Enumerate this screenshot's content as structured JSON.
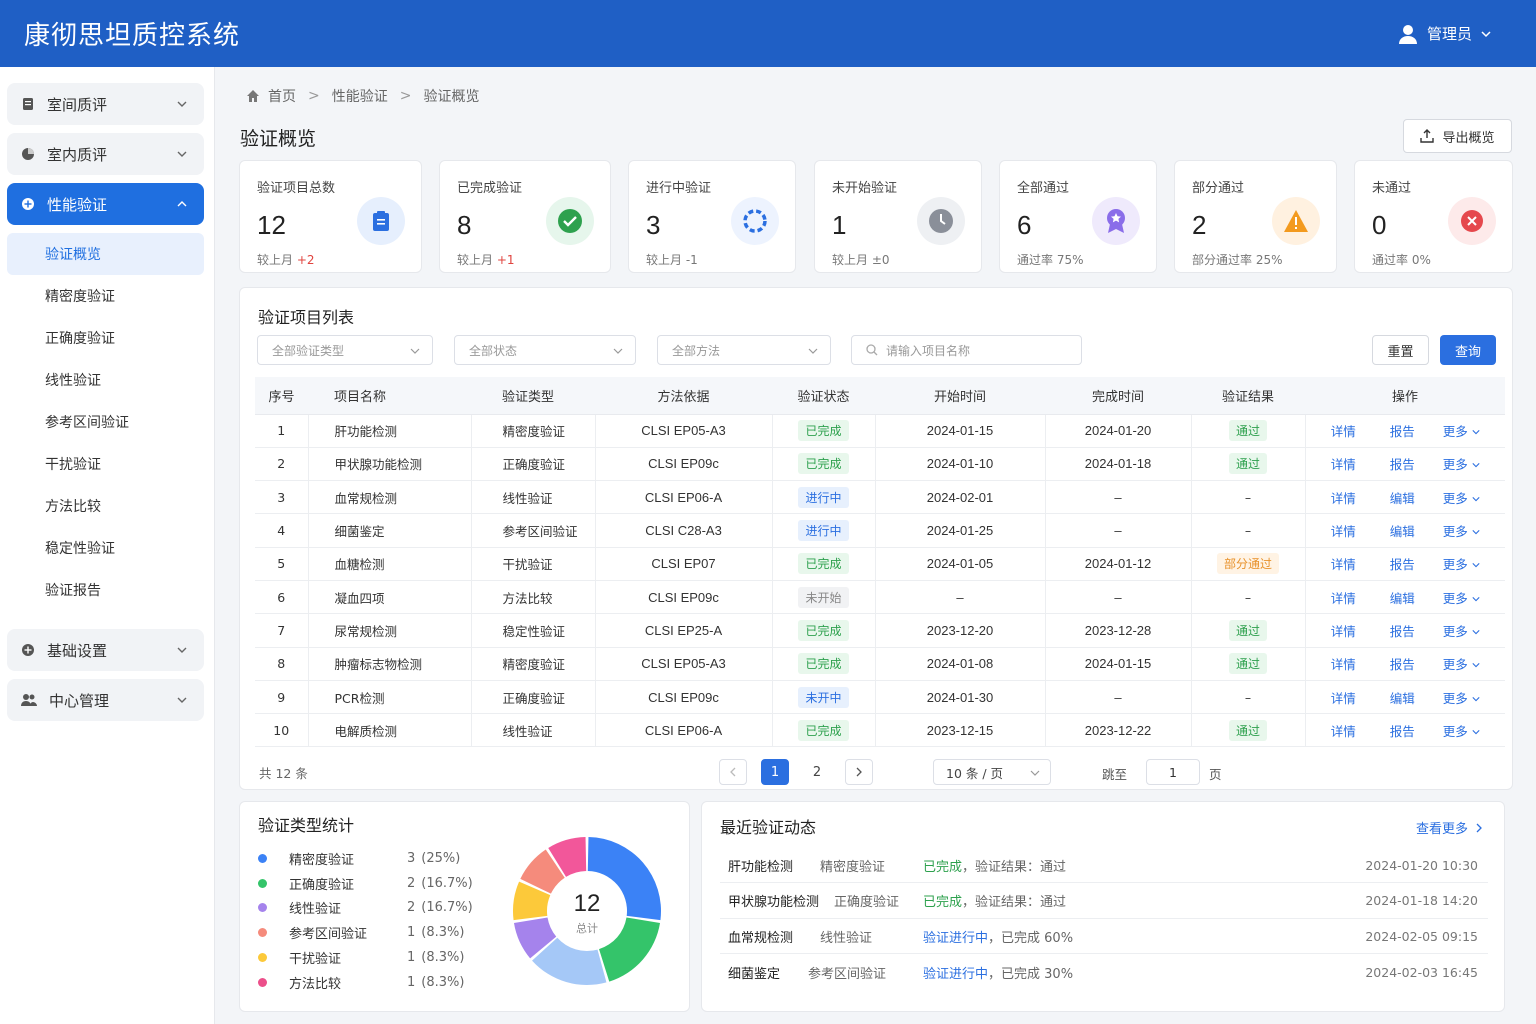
{
  "app_title": "康彻思坦质控系统",
  "user": {
    "name": "管理员"
  },
  "sidebar": {
    "groups_top": [
      {
        "label": "室间质评"
      },
      {
        "label": "室内质评"
      }
    ],
    "active_group": {
      "label": "性能验证"
    },
    "sub_items": [
      {
        "label": "验证概览"
      },
      {
        "label": "精密度验证"
      },
      {
        "label": "正确度验证"
      },
      {
        "label": "线性验证"
      },
      {
        "label": "参考区间验证"
      },
      {
        "label": "干扰验证"
      },
      {
        "label": "方法比较"
      },
      {
        "label": "稳定性验证"
      },
      {
        "label": "验证报告"
      }
    ],
    "groups_bottom": [
      {
        "label": "基础设置"
      },
      {
        "label": "中心管理"
      }
    ]
  },
  "breadcrumb": {
    "home": "首页",
    "level1": "性能验证",
    "level2": "验证概览"
  },
  "page_title": "验证概览",
  "export_label": "导出概览",
  "stats": [
    {
      "label": "验证项目总数",
      "value": "12",
      "sub_prefix": "较上月",
      "sub_value": "+2",
      "color": "#2b6fe0",
      "icon": "clipboard-icon"
    },
    {
      "label": "已完成验证",
      "value": "8",
      "sub_prefix": "较上月",
      "sub_value": "+1",
      "color": "#2ea14e",
      "icon": "check-circle-icon"
    },
    {
      "label": "进行中验证",
      "value": "3",
      "sub_prefix": "较上月",
      "sub_value": "-1",
      "color": "#2b6fe0",
      "icon": "loading-ring-icon"
    },
    {
      "label": "未开始验证",
      "value": "1",
      "sub_prefix": "较上月",
      "sub_value": "±0",
      "color": "#8a8f99",
      "icon": "clock-icon"
    },
    {
      "label": "全部通过",
      "value": "6",
      "sub_prefix": "通过率",
      "sub_value": "75%",
      "color": "#8a6de9",
      "icon": "award-icon"
    },
    {
      "label": "部分通过",
      "value": "2",
      "sub_prefix": "部分通过率",
      "sub_value": "25%",
      "color": "#f39a1e",
      "icon": "warning-icon"
    },
    {
      "label": "未通过",
      "value": "0",
      "sub_prefix": "通过率",
      "sub_value": "0%",
      "color": "#e5484d",
      "icon": "x-circle-icon"
    }
  ],
  "list": {
    "title": "验证项目列表",
    "filters": {
      "type": "全部验证类型",
      "status": "全部状态",
      "method": "全部方法",
      "search_placeholder": "请输入项目名称"
    },
    "reset_label": "重置",
    "query_label": "查询",
    "columns": [
      "序号",
      "项目名称",
      "验证类型",
      "方法依据",
      "验证状态",
      "开始时间",
      "完成时间",
      "验证结果",
      "操作"
    ],
    "rows": [
      {
        "no": "1",
        "name": "肝功能检测",
        "type": "精密度验证",
        "method": "CLSI EP05-A3",
        "status": "已完成",
        "status_kind": "done",
        "start": "2024-01-15",
        "end": "2024-01-20",
        "result": "通过",
        "result_kind": "pass",
        "op1": "详情",
        "op2": "报告",
        "op3": "更多"
      },
      {
        "no": "2",
        "name": "甲状腺功能检测",
        "type": "正确度验证",
        "method": "CLSI EP09c",
        "status": "已完成",
        "status_kind": "done",
        "start": "2024-01-10",
        "end": "2024-01-18",
        "result": "通过",
        "result_kind": "pass",
        "op1": "详情",
        "op2": "报告",
        "op3": "更多"
      },
      {
        "no": "3",
        "name": "血常规检测",
        "type": "线性验证",
        "method": "CLSI EP06-A",
        "status": "进行中",
        "status_kind": "prog",
        "start": "2024-02-01",
        "end": "–",
        "result": "–",
        "result_kind": "none",
        "op1": "详情",
        "op2": "编辑",
        "op3": "更多"
      },
      {
        "no": "4",
        "name": "细菌鉴定",
        "type": "参考区间验证",
        "method": "CLSI C28-A3",
        "status": "进行中",
        "status_kind": "prog",
        "start": "2024-01-25",
        "end": "–",
        "result": "–",
        "result_kind": "none",
        "op1": "详情",
        "op2": "编辑",
        "op3": "更多"
      },
      {
        "no": "5",
        "name": "血糖检测",
        "type": "干扰验证",
        "method": "CLSI EP07",
        "status": "已完成",
        "status_kind": "done",
        "start": "2024-01-05",
        "end": "2024-01-12",
        "result": "部分通过",
        "result_kind": "part",
        "op1": "详情",
        "op2": "报告",
        "op3": "更多"
      },
      {
        "no": "6",
        "name": "凝血四项",
        "type": "方法比较",
        "method": "CLSI EP09c",
        "status": "未开始",
        "status_kind": "wait",
        "start": "–",
        "end": "–",
        "result": "–",
        "result_kind": "none",
        "op1": "详情",
        "op2": "编辑",
        "op3": "更多"
      },
      {
        "no": "7",
        "name": "尿常规检测",
        "type": "稳定性验证",
        "method": "CLSI EP25-A",
        "status": "已完成",
        "status_kind": "done",
        "start": "2023-12-20",
        "end": "2023-12-28",
        "result": "通过",
        "result_kind": "pass",
        "op1": "详情",
        "op2": "报告",
        "op3": "更多"
      },
      {
        "no": "8",
        "name": "肿瘤标志物检测",
        "type": "精密度验证",
        "method": "CLSI EP05-A3",
        "status": "已完成",
        "status_kind": "done",
        "start": "2024-01-08",
        "end": "2024-01-15",
        "result": "通过",
        "result_kind": "pass",
        "op1": "详情",
        "op2": "报告",
        "op3": "更多"
      },
      {
        "no": "9",
        "name": "PCR检测",
        "type": "正确度验证",
        "method": "CLSI EP09c",
        "status": "未开中",
        "status_kind": "prog",
        "start": "2024-01-30",
        "end": "–",
        "result": "–",
        "result_kind": "none",
        "op1": "详情",
        "op2": "编辑",
        "op3": "更多"
      },
      {
        "no": "10",
        "name": "电解质检测",
        "type": "线性验证",
        "method": "CLSI EP06-A",
        "status": "已完成",
        "status_kind": "done",
        "start": "2023-12-15",
        "end": "2023-12-22",
        "result": "通过",
        "result_kind": "pass",
        "op1": "详情",
        "op2": "报告",
        "op3": "更多"
      }
    ],
    "total_label": "共 12 条",
    "pages": [
      "1",
      "2"
    ],
    "current_page": "1",
    "page_size": "10 条 / 页",
    "jump_label": "跳至",
    "jump_value": "1",
    "page_unit": "页"
  },
  "type_stats": {
    "title": "验证类型统计",
    "total_value": "12",
    "total_label": "总计",
    "items": [
      {
        "name": "精密度验证",
        "count": "3",
        "pct": "(25%)",
        "value": 3,
        "color": "#3b82f6"
      },
      {
        "name": "正确度验证",
        "count": "2",
        "pct": "(16.7%)",
        "value": 2,
        "color": "#34c46a"
      },
      {
        "name": "线性验证",
        "count": "2",
        "pct": "(16.7%)",
        "value": 2,
        "color": "#a5c8f7"
      },
      {
        "name": "参考区间验证",
        "count": "1",
        "pct": "(8.3%)",
        "value": 1,
        "color": "#a583ec"
      },
      {
        "name": "干扰验证",
        "count": "1",
        "pct": "(8.3%)",
        "value": 1,
        "color": "#fcc93a"
      },
      {
        "name": "方法比较",
        "count": "1",
        "pct": "(8.3%)",
        "value": 1,
        "color": "#f58b7c"
      }
    ],
    "legend_colors": [
      "#3b82f6",
      "#34c46a",
      "#a583ec",
      "#f58b7c",
      "#fcc93a",
      "#ec4f8a"
    ],
    "extra_slice_color": "#f2579a"
  },
  "recent": {
    "title": "最近验证动态",
    "more_label": "查看更多",
    "items": [
      {
        "name": "肝功能检测",
        "type": "精密度验证",
        "status": "已完成",
        "detail": "，验证结果：通过",
        "time": "2024-01-20 10:30",
        "kind": "done"
      },
      {
        "name": "甲状腺功能检测",
        "type": "正确度验证",
        "status": "已完成",
        "detail": "，验证结果：通过",
        "time": "2024-01-18 14:20",
        "kind": "done"
      },
      {
        "name": "血常规检测",
        "type": "线性验证",
        "status": "验证进行中",
        "detail": "，已完成 60%",
        "time": "2024-02-05 09:15",
        "kind": "prog"
      },
      {
        "name": "细菌鉴定",
        "type": "参考区间验证",
        "status": "验证进行中",
        "detail": "，已完成 30%",
        "time": "2024-02-03 16:45",
        "kind": "prog"
      }
    ]
  }
}
